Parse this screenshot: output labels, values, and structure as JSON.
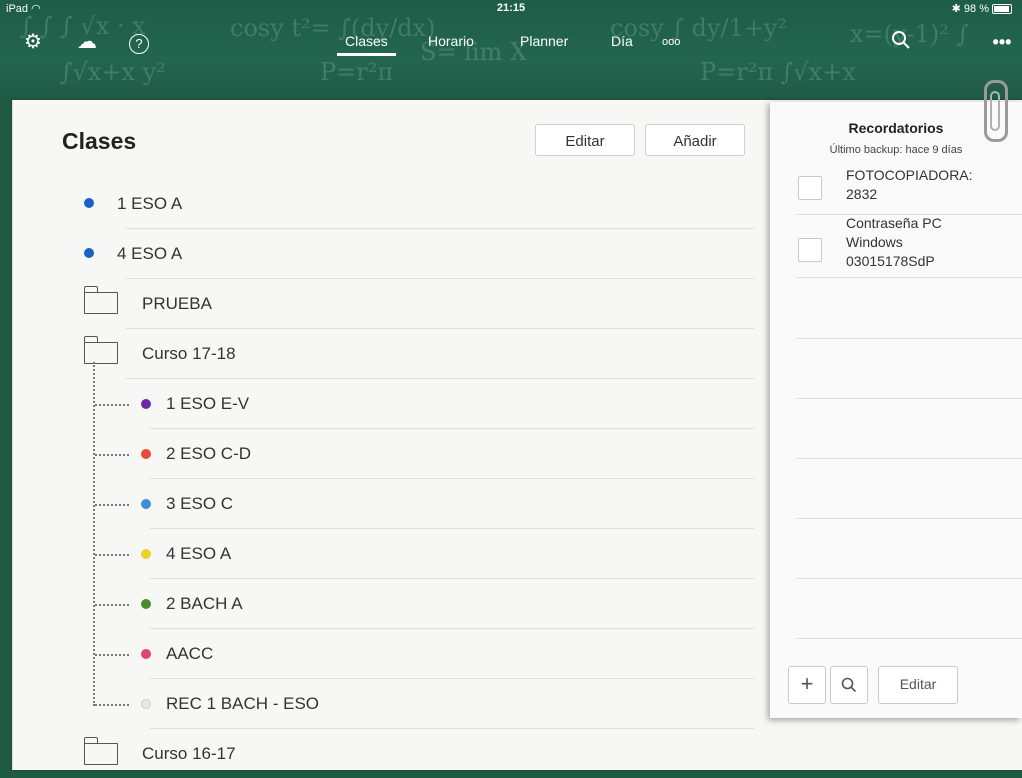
{
  "status_bar": {
    "device": "iPad",
    "time": "21:15",
    "battery": "98 %"
  },
  "top_bar": {
    "tabs": [
      {
        "label": "Clases",
        "active": true
      },
      {
        "label": "Horario",
        "active": false
      },
      {
        "label": "Planner",
        "active": false
      },
      {
        "label": "Día",
        "active": false
      },
      {
        "label": "ooo",
        "active": false
      }
    ]
  },
  "classes": {
    "title": "Clases",
    "edit_label": "Editar",
    "add_label": "Añadir",
    "items": [
      {
        "label": "1 ESO A",
        "kind": "class",
        "color": "#1a63c6"
      },
      {
        "label": "4 ESO A",
        "kind": "class",
        "color": "#1a63c6"
      },
      {
        "label": "PRUEBA",
        "kind": "folder"
      },
      {
        "label": "Curso 17-18",
        "kind": "folder-open"
      },
      {
        "label": "1 ESO E-V",
        "kind": "child",
        "color": "#6a2aa8"
      },
      {
        "label": "2 ESO C-D",
        "kind": "child",
        "color": "#e84a3a"
      },
      {
        "label": "3 ESO C",
        "kind": "child",
        "color": "#3a8fde"
      },
      {
        "label": "4 ESO A",
        "kind": "child",
        "color": "#f0d02a"
      },
      {
        "label": "2 BACH A",
        "kind": "child",
        "color": "#4b8a2e"
      },
      {
        "label": "AACC",
        "kind": "child",
        "color": "#e0456e"
      },
      {
        "label": "REC 1 BACH  - ESO",
        "kind": "child",
        "color": "#d8d8d8"
      },
      {
        "label": "Curso 16-17",
        "kind": "folder"
      }
    ]
  },
  "reminders": {
    "title": "Recordatorios",
    "subtitle": "Último backup: hace 9 días",
    "items": [
      {
        "text": "FOTOCOPIADORA:\n2832"
      },
      {
        "text": "Contraseña PC\nWindows\n03015178SdP"
      }
    ],
    "add_symbol": "+",
    "edit_label": "Editar"
  },
  "icons": {
    "settings": "gear-icon",
    "cloud": "cloud-upload-icon",
    "help": "help-icon",
    "search": "search-icon",
    "more": "more-icon"
  }
}
